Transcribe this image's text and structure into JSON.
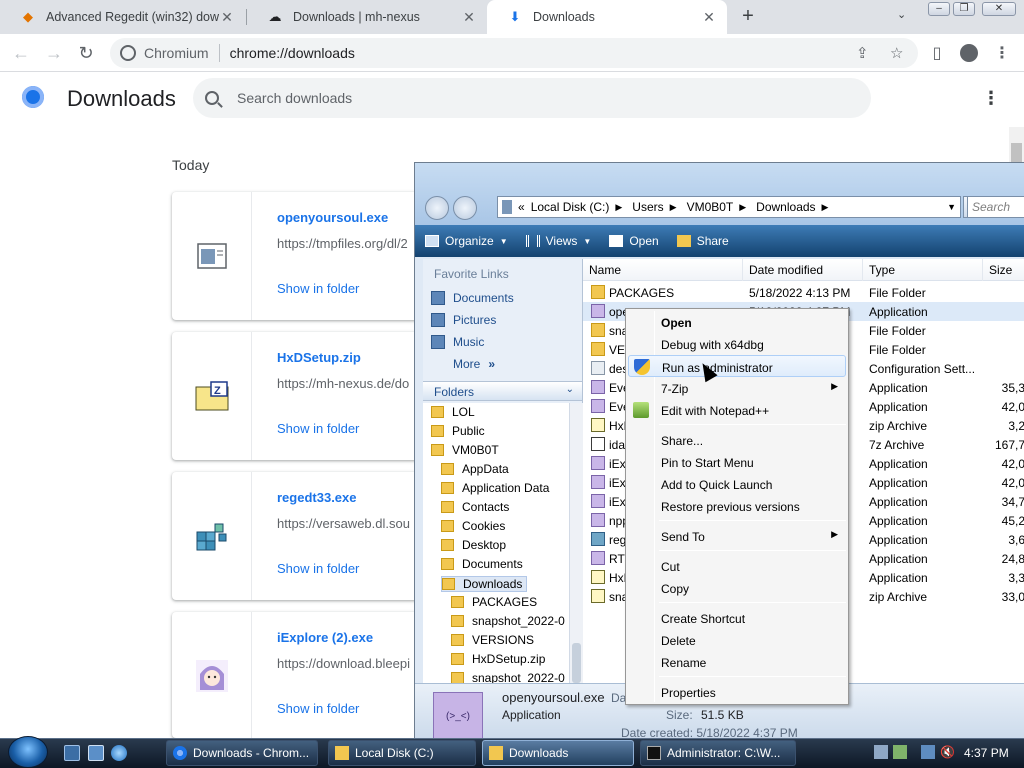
{
  "browser": {
    "tabs": [
      {
        "title": "Advanced Regedit (win32) downl",
        "icon": "regedit-diamond-icon"
      },
      {
        "title": "Downloads | mh-nexus",
        "icon": "mh-nexus-icon"
      },
      {
        "title": "Downloads",
        "icon": "download-icon"
      }
    ],
    "new_tab_label": "+",
    "tab_list_label": "⌄",
    "omnibox": {
      "site_label": "Chromium",
      "url": "chrome://downloads"
    }
  },
  "downloads_page": {
    "title": "Downloads",
    "search_placeholder": "Search downloads",
    "section_today": "Today",
    "items": [
      {
        "name": "openyoursoul.exe",
        "url": "https://tmpfiles.org/dl/2",
        "action": "Show in folder",
        "icon": "window-app-icon"
      },
      {
        "name": "HxDSetup.zip",
        "url": "https://mh-nexus.de/do",
        "action": "Show in folder",
        "icon": "zip-folder-icon"
      },
      {
        "name": "regedt33.exe",
        "url": "https://versaweb.dl.sou",
        "action": "Show in folder",
        "icon": "registry-cubes-icon"
      },
      {
        "name": "iExplore (2).exe",
        "url": "https://download.bleepi",
        "action": "Show in folder",
        "icon": "anime-avatar-icon"
      }
    ]
  },
  "explorer": {
    "address": [
      "Local Disk (C:)",
      "Users",
      "VM0B0T",
      "Downloads"
    ],
    "address_prefix": "«",
    "search_placeholder": "Search",
    "commands": [
      "Organize",
      "Views",
      "Open",
      "Share"
    ],
    "favorites_header": "Favorite Links",
    "favorites": [
      "Documents",
      "Pictures",
      "Music"
    ],
    "favorites_more": "More",
    "folders_header": "Folders",
    "tree": [
      {
        "label": "LOL",
        "indent": 0
      },
      {
        "label": "Public",
        "indent": 0
      },
      {
        "label": "VM0B0T",
        "indent": 0
      },
      {
        "label": "AppData",
        "indent": 1
      },
      {
        "label": "Application Data",
        "indent": 1
      },
      {
        "label": "Contacts",
        "indent": 1
      },
      {
        "label": "Cookies",
        "indent": 1
      },
      {
        "label": "Desktop",
        "indent": 1
      },
      {
        "label": "Documents",
        "indent": 1
      },
      {
        "label": "Downloads",
        "indent": 1,
        "selected": true
      },
      {
        "label": "PACKAGES",
        "indent": 2
      },
      {
        "label": "snapshot_2022-0",
        "indent": 2
      },
      {
        "label": "VERSIONS",
        "indent": 2
      },
      {
        "label": "HxDSetup.zip",
        "indent": 2
      },
      {
        "label": "snapshot_2022-0",
        "indent": 2
      }
    ],
    "columns": [
      "Name",
      "Date modified",
      "Type",
      "Size"
    ],
    "files": [
      {
        "name": "PACKAGES",
        "date": "5/18/2022 4:13 PM",
        "type": "File Folder",
        "size": "",
        "icon": "folder"
      },
      {
        "name": "ope",
        "date": "5/18/2022 4:37 PM",
        "type": "Application",
        "size": "",
        "icon": "app",
        "selected": true
      },
      {
        "name": "sna",
        "date": "",
        "type": "File Folder",
        "size": "",
        "icon": "folder"
      },
      {
        "name": "VER",
        "date": "",
        "type": "File Folder",
        "size": "",
        "icon": "folder"
      },
      {
        "name": "des",
        "date": "",
        "type": "Configuration Sett...",
        "size": "",
        "icon": "cfg"
      },
      {
        "name": "Eve",
        "date": "",
        "type": "Application",
        "size": "35,3",
        "icon": "app"
      },
      {
        "name": "Eve",
        "date": "",
        "type": "Application",
        "size": "42,0",
        "icon": "app"
      },
      {
        "name": "HxD",
        "date": "",
        "type": "zip Archive",
        "size": "3,2",
        "icon": "zip"
      },
      {
        "name": "ida6",
        "date": "",
        "type": "7z Archive",
        "size": "167,7",
        "icon": "7z"
      },
      {
        "name": "iExp",
        "date": "",
        "type": "Application",
        "size": "42,0",
        "icon": "app"
      },
      {
        "name": "iExp",
        "date": "",
        "type": "Application",
        "size": "42,0",
        "icon": "app"
      },
      {
        "name": "iExp",
        "date": "",
        "type": "Application",
        "size": "34,7",
        "icon": "app"
      },
      {
        "name": "npp",
        "date": "",
        "type": "Application",
        "size": "45,2",
        "icon": "app"
      },
      {
        "name": "reg",
        "date": "",
        "type": "Application",
        "size": "3,6",
        "icon": "reg"
      },
      {
        "name": "RTC",
        "date": "",
        "type": "Application",
        "size": "24,8",
        "icon": "app"
      },
      {
        "name": "HxD",
        "date": "",
        "type": "Application",
        "size": "3,3",
        "icon": "zip"
      },
      {
        "name": "sna",
        "date": "",
        "type": "zip Archive",
        "size": "33,0",
        "icon": "zip"
      }
    ],
    "details": {
      "name": "openyoursoul.exe",
      "type": "Application",
      "label_date": "Da",
      "size_label": "Size:",
      "size_value": "51.5 KB",
      "created": "Date created: 5/18/2022 4:37 PM"
    }
  },
  "context_menu": {
    "items": [
      {
        "label": "Open",
        "bold": true
      },
      {
        "label": "Debug with x64dbg"
      },
      {
        "label": "Run as administrator",
        "icon": "uac-shield-icon",
        "hover": true
      },
      {
        "label": "7-Zip",
        "submenu": true
      },
      {
        "label": "Edit with Notepad++",
        "icon": "notepad-plus-plus-icon"
      },
      {
        "sep": true
      },
      {
        "label": "Share..."
      },
      {
        "label": "Pin to Start Menu"
      },
      {
        "label": "Add to Quick Launch"
      },
      {
        "label": "Restore previous versions"
      },
      {
        "sep": true
      },
      {
        "label": "Send To",
        "submenu": true
      },
      {
        "sep": true
      },
      {
        "label": "Cut"
      },
      {
        "label": "Copy"
      },
      {
        "sep": true
      },
      {
        "label": "Create Shortcut"
      },
      {
        "label": "Delete"
      },
      {
        "label": "Rename"
      },
      {
        "sep": true
      },
      {
        "label": "Properties"
      }
    ]
  },
  "taskbar": {
    "buttons": [
      {
        "label": "Downloads - Chrom...",
        "icon": "chromium-icon"
      },
      {
        "label": "Local Disk (C:)",
        "icon": "explorer-folder-icon"
      },
      {
        "label": "Downloads",
        "icon": "explorer-folder-icon",
        "active": true
      },
      {
        "label": "Administrator: C:\\W...",
        "icon": "cmd-icon"
      }
    ],
    "clock": "4:37 PM"
  },
  "colors": {
    "accent": "#1a73e8",
    "taskbar": "#1c2f47",
    "menu_hover": "#dfecfb"
  }
}
